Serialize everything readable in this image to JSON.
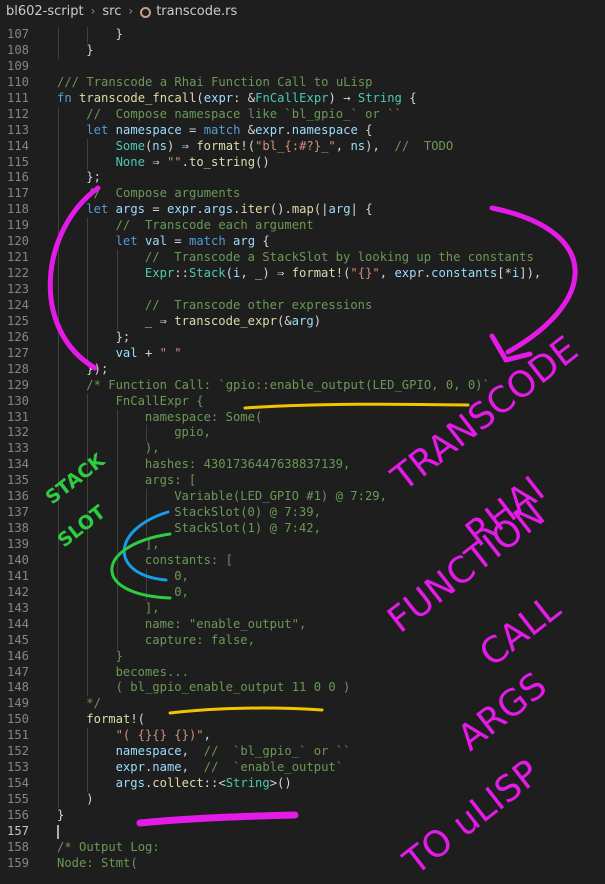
{
  "breadcrumb": {
    "folder": "bl602-script",
    "subfolder": "src",
    "file": "transcode.rs"
  },
  "cursor_line": 157,
  "lines": [
    {
      "n": "107",
      "indent": 2,
      "segs": [
        [
          "c-txt",
          "}"
        ]
      ]
    },
    {
      "n": "108",
      "indent": 1,
      "segs": [
        [
          "c-txt",
          "}"
        ]
      ]
    },
    {
      "n": "109",
      "indent": 0,
      "segs": []
    },
    {
      "n": "110",
      "indent": 0,
      "segs": [
        [
          "c-com",
          "/// Transcode a Rhai Function Call to uLisp"
        ]
      ]
    },
    {
      "n": "111",
      "indent": 0,
      "segs": [
        [
          "c-kw",
          "fn "
        ],
        [
          "c-fn",
          "transcode_fncall"
        ],
        [
          "c-txt",
          "("
        ],
        [
          "c-var",
          "expr"
        ],
        [
          "c-txt",
          ": &"
        ],
        [
          "c-ty",
          "FnCallExpr"
        ],
        [
          "c-txt",
          ") → "
        ],
        [
          "c-ty",
          "String"
        ],
        [
          "c-txt",
          " {"
        ]
      ]
    },
    {
      "n": "112",
      "indent": 1,
      "segs": [
        [
          "c-com",
          "//  Compose namespace like `bl_gpio_` or ``"
        ]
      ]
    },
    {
      "n": "113",
      "indent": 1,
      "segs": [
        [
          "c-kw",
          "let "
        ],
        [
          "c-var",
          "namespace"
        ],
        [
          "c-txt",
          " = "
        ],
        [
          "c-kw",
          "match"
        ],
        [
          "c-txt",
          " &"
        ],
        [
          "c-var",
          "expr"
        ],
        [
          "c-txt",
          "."
        ],
        [
          "c-var",
          "namespace"
        ],
        [
          "c-txt",
          " {"
        ]
      ]
    },
    {
      "n": "114",
      "indent": 2,
      "segs": [
        [
          "c-ty",
          "Some"
        ],
        [
          "c-txt",
          "("
        ],
        [
          "c-var",
          "ns"
        ],
        [
          "c-txt",
          ") ⇒ "
        ],
        [
          "c-fn",
          "format!"
        ],
        [
          "c-txt",
          "("
        ],
        [
          "c-str",
          "\"bl_{:#?}_\""
        ],
        [
          "c-txt",
          ", "
        ],
        [
          "c-var",
          "ns"
        ],
        [
          "c-txt",
          "),  "
        ],
        [
          "c-com",
          "//  TODO"
        ]
      ]
    },
    {
      "n": "115",
      "indent": 2,
      "segs": [
        [
          "c-ty",
          "None"
        ],
        [
          "c-txt",
          " ⇒ "
        ],
        [
          "c-str",
          "\"\""
        ],
        [
          "c-txt",
          "."
        ],
        [
          "c-fn",
          "to_string"
        ],
        [
          "c-txt",
          "()"
        ]
      ]
    },
    {
      "n": "116",
      "indent": 1,
      "segs": [
        [
          "c-txt",
          "};"
        ]
      ]
    },
    {
      "n": "117",
      "indent": 1,
      "segs": [
        [
          "c-com",
          "//  Compose arguments"
        ]
      ]
    },
    {
      "n": "118",
      "indent": 1,
      "segs": [
        [
          "c-kw",
          "let "
        ],
        [
          "c-var",
          "args"
        ],
        [
          "c-txt",
          " = "
        ],
        [
          "c-var",
          "expr"
        ],
        [
          "c-txt",
          "."
        ],
        [
          "c-var",
          "args"
        ],
        [
          "c-txt",
          "."
        ],
        [
          "c-fn",
          "iter"
        ],
        [
          "c-txt",
          "()."
        ],
        [
          "c-fn",
          "map"
        ],
        [
          "c-txt",
          "(|"
        ],
        [
          "c-var",
          "arg"
        ],
        [
          "c-txt",
          "| {"
        ]
      ]
    },
    {
      "n": "119",
      "indent": 2,
      "segs": [
        [
          "c-com",
          "//  Transcode each argument"
        ]
      ]
    },
    {
      "n": "120",
      "indent": 2,
      "segs": [
        [
          "c-kw",
          "let "
        ],
        [
          "c-var",
          "val"
        ],
        [
          "c-txt",
          " = "
        ],
        [
          "c-kw",
          "match"
        ],
        [
          "c-txt",
          " "
        ],
        [
          "c-var",
          "arg"
        ],
        [
          "c-txt",
          " {"
        ]
      ]
    },
    {
      "n": "121",
      "indent": 3,
      "segs": [
        [
          "c-com",
          "//  Transcode a StackSlot by looking up the constants"
        ]
      ]
    },
    {
      "n": "122",
      "indent": 3,
      "segs": [
        [
          "c-ty",
          "Expr"
        ],
        [
          "c-txt",
          "::"
        ],
        [
          "c-ty",
          "Stack"
        ],
        [
          "c-txt",
          "("
        ],
        [
          "c-var",
          "i"
        ],
        [
          "c-txt",
          ", _) ⇒ "
        ],
        [
          "c-fn",
          "format!"
        ],
        [
          "c-txt",
          "("
        ],
        [
          "c-str",
          "\"{}\""
        ],
        [
          "c-txt",
          ", "
        ],
        [
          "c-var",
          "expr"
        ],
        [
          "c-txt",
          "."
        ],
        [
          "c-var",
          "constants"
        ],
        [
          "c-txt",
          "[*"
        ],
        [
          "c-var",
          "i"
        ],
        [
          "c-txt",
          "]),"
        ]
      ]
    },
    {
      "n": "123",
      "indent": 3,
      "segs": []
    },
    {
      "n": "124",
      "indent": 3,
      "segs": [
        [
          "c-com",
          "//  Transcode other expressions"
        ]
      ]
    },
    {
      "n": "125",
      "indent": 3,
      "segs": [
        [
          "c-txt",
          "_ ⇒ "
        ],
        [
          "c-fn",
          "transcode_expr"
        ],
        [
          "c-txt",
          "(&"
        ],
        [
          "c-var",
          "arg"
        ],
        [
          "c-txt",
          ")"
        ]
      ]
    },
    {
      "n": "126",
      "indent": 2,
      "segs": [
        [
          "c-txt",
          "};"
        ]
      ]
    },
    {
      "n": "127",
      "indent": 2,
      "segs": [
        [
          "c-var",
          "val"
        ],
        [
          "c-txt",
          " + "
        ],
        [
          "c-str",
          "\" \""
        ]
      ]
    },
    {
      "n": "128",
      "indent": 1,
      "segs": [
        [
          "c-txt",
          "});"
        ]
      ]
    },
    {
      "n": "129",
      "indent": 1,
      "segs": [
        [
          "c-com",
          "/* Function Call: `gpio::enable_output(LED_GPIO, 0, 0)`"
        ]
      ]
    },
    {
      "n": "130",
      "indent": 2,
      "segs": [
        [
          "c-com",
          "FnCallExpr {"
        ]
      ]
    },
    {
      "n": "131",
      "indent": 3,
      "segs": [
        [
          "c-com",
          "namespace: Some("
        ]
      ]
    },
    {
      "n": "132",
      "indent": 4,
      "segs": [
        [
          "c-com",
          "gpio,"
        ]
      ]
    },
    {
      "n": "133",
      "indent": 3,
      "segs": [
        [
          "c-com",
          "),"
        ]
      ]
    },
    {
      "n": "134",
      "indent": 3,
      "segs": [
        [
          "c-com",
          "hashes: 4301736447638837139,"
        ]
      ]
    },
    {
      "n": "135",
      "indent": 3,
      "segs": [
        [
          "c-com",
          "args: ["
        ]
      ]
    },
    {
      "n": "136",
      "indent": 4,
      "segs": [
        [
          "c-com",
          "Variable(LED_GPIO #1) @ 7:29,"
        ]
      ]
    },
    {
      "n": "137",
      "indent": 4,
      "segs": [
        [
          "c-com",
          "StackSlot(0) @ 7:39,"
        ]
      ]
    },
    {
      "n": "138",
      "indent": 4,
      "segs": [
        [
          "c-com",
          "StackSlot(1) @ 7:42,"
        ]
      ]
    },
    {
      "n": "139",
      "indent": 3,
      "segs": [
        [
          "c-com",
          "],"
        ]
      ]
    },
    {
      "n": "140",
      "indent": 3,
      "segs": [
        [
          "c-com",
          "constants: ["
        ]
      ]
    },
    {
      "n": "141",
      "indent": 4,
      "segs": [
        [
          "c-com",
          "0,"
        ]
      ]
    },
    {
      "n": "142",
      "indent": 4,
      "segs": [
        [
          "c-com",
          "0,"
        ]
      ]
    },
    {
      "n": "143",
      "indent": 3,
      "segs": [
        [
          "c-com",
          "],"
        ]
      ]
    },
    {
      "n": "144",
      "indent": 3,
      "segs": [
        [
          "c-com",
          "name: \"enable_output\","
        ]
      ]
    },
    {
      "n": "145",
      "indent": 3,
      "segs": [
        [
          "c-com",
          "capture: false,"
        ]
      ]
    },
    {
      "n": "146",
      "indent": 2,
      "segs": [
        [
          "c-com",
          "}"
        ]
      ]
    },
    {
      "n": "147",
      "indent": 2,
      "segs": [
        [
          "c-com",
          "becomes..."
        ]
      ]
    },
    {
      "n": "148",
      "indent": 2,
      "segs": [
        [
          "c-com",
          "( bl_gpio_enable_output 11 0 0 )"
        ]
      ]
    },
    {
      "n": "149",
      "indent": 1,
      "segs": [
        [
          "c-com",
          "*/"
        ]
      ]
    },
    {
      "n": "150",
      "indent": 1,
      "segs": [
        [
          "c-fn",
          "format!"
        ],
        [
          "c-txt",
          "("
        ]
      ]
    },
    {
      "n": "151",
      "indent": 2,
      "segs": [
        [
          "c-str",
          "\"( {}{} {})\""
        ],
        [
          "c-txt",
          ","
        ]
      ]
    },
    {
      "n": "152",
      "indent": 2,
      "segs": [
        [
          "c-var",
          "namespace"
        ],
        [
          "c-txt",
          ",  "
        ],
        [
          "c-com",
          "//  `bl_gpio_` or ``"
        ]
      ]
    },
    {
      "n": "153",
      "indent": 2,
      "segs": [
        [
          "c-var",
          "expr"
        ],
        [
          "c-txt",
          "."
        ],
        [
          "c-var",
          "name"
        ],
        [
          "c-txt",
          ",  "
        ],
        [
          "c-com",
          "//  `enable_output`"
        ]
      ]
    },
    {
      "n": "154",
      "indent": 2,
      "segs": [
        [
          "c-var",
          "args"
        ],
        [
          "c-txt",
          "."
        ],
        [
          "c-fn",
          "collect"
        ],
        [
          "c-txt",
          "::<"
        ],
        [
          "c-ty",
          "String"
        ],
        [
          "c-txt",
          ">()"
        ]
      ]
    },
    {
      "n": "155",
      "indent": 1,
      "segs": [
        [
          "c-txt",
          ")"
        ]
      ]
    },
    {
      "n": "156",
      "indent": 0,
      "segs": [
        [
          "c-txt",
          "}"
        ]
      ]
    },
    {
      "n": "157",
      "indent": 0,
      "segs": []
    },
    {
      "n": "158",
      "indent": 0,
      "segs": [
        [
          "c-com",
          "/* Output Log:"
        ]
      ]
    },
    {
      "n": "159",
      "indent": 0,
      "segs": [
        [
          "c-com",
          "Node: Stmt("
        ]
      ]
    }
  ],
  "annotations": {
    "stack_slot": [
      "STACK",
      "SLOT"
    ],
    "transcode": [
      "TRANSCODE",
      "RHAI",
      "FUNCTION",
      "CALL",
      "ARGS",
      "TO uLISP"
    ],
    "colors": {
      "magenta": "#e41be6",
      "yellow": "#f2c300",
      "blue": "#1a9ce6",
      "green": "#2ecc40"
    }
  }
}
